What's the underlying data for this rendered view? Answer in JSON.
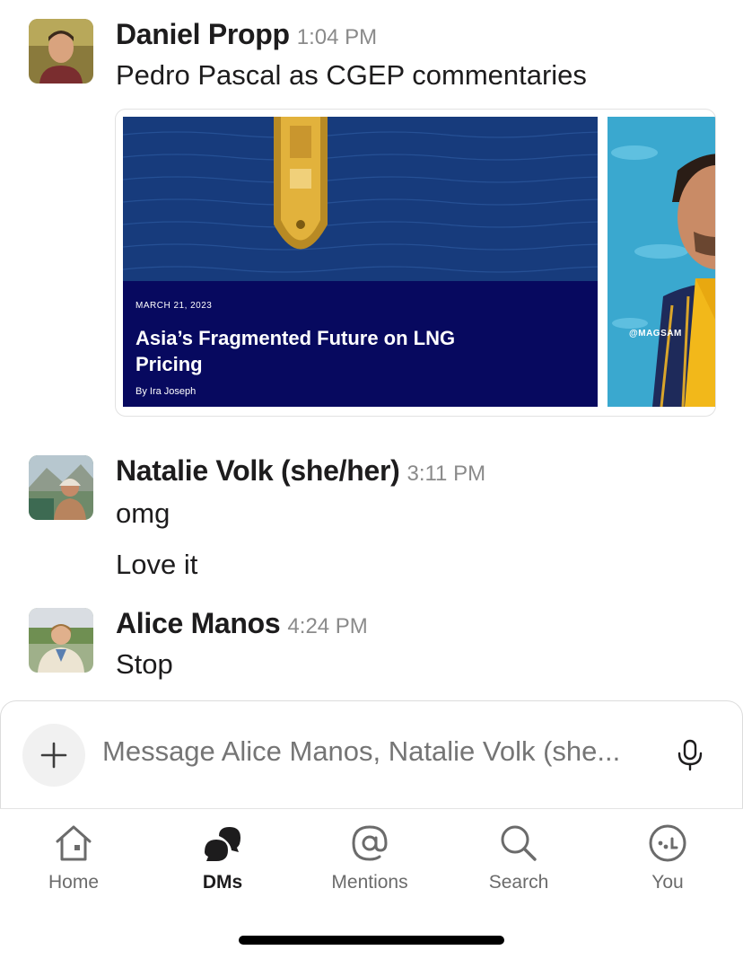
{
  "messages": [
    {
      "author": "Daniel Propp",
      "time": "1:04 PM",
      "lines": [
        "Pedro Pascal as CGEP commentaries"
      ]
    },
    {
      "author": "Natalie Volk (she/her)",
      "time": "3:11 PM",
      "lines": [
        "omg",
        "Love it"
      ]
    },
    {
      "author": "Alice Manos",
      "time": "4:24 PM",
      "lines": [
        "Stop"
      ]
    }
  ],
  "attachment": {
    "article": {
      "date": "MARCH 21, 2023",
      "title": "Asia’s Fragmented Future on LNG Pricing",
      "byline": "By Ira Joseph"
    },
    "photo_watermark": "@MAGSAM"
  },
  "composer": {
    "placeholder": "Message Alice Manos, Natalie Volk (she...",
    "plus_icon": "plus-icon",
    "mic_icon": "microphone-icon"
  },
  "tabs": [
    {
      "label": "Home",
      "icon": "home-icon"
    },
    {
      "label": "DMs",
      "icon": "dms-icon",
      "active": true
    },
    {
      "label": "Mentions",
      "icon": "at-icon"
    },
    {
      "label": "Search",
      "icon": "search-icon"
    },
    {
      "label": "You",
      "icon": "you-icon"
    }
  ],
  "colors": {
    "text": "#1d1c1d",
    "muted": "#8a8a8a",
    "article_bg": "#07095f",
    "active_tab": "#1d1c1d",
    "inactive_tab": "#6b6b6b"
  }
}
